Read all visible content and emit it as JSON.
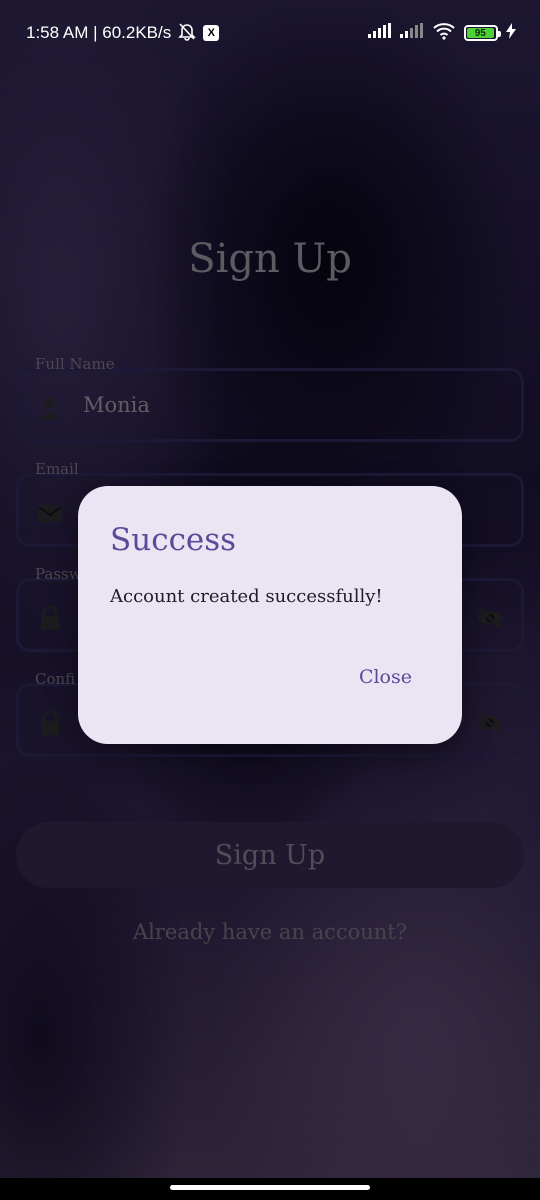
{
  "status_bar": {
    "time_speed": "1:58 AM | 60.2KB/s",
    "x_app": "X",
    "battery": "95"
  },
  "page": {
    "title": "Sign Up",
    "fields": [
      {
        "label": "Full Name",
        "value": "Monia"
      },
      {
        "label": "Email",
        "value": ""
      },
      {
        "label": "Passw",
        "value": ""
      },
      {
        "label": "Confi",
        "value": ""
      }
    ],
    "signup_button": "Sign Up",
    "login_link": "Already have an account?"
  },
  "dialog": {
    "title": "Success",
    "message": "Account created successfully!",
    "close_label": "Close"
  },
  "colors": {
    "accent": "#5a4a9a",
    "dialog_bg": "#ebe4f2"
  }
}
